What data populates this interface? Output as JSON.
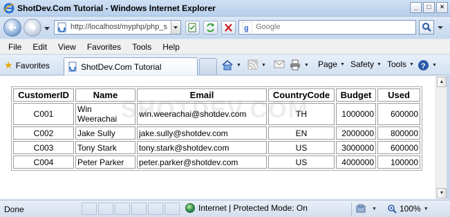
{
  "window": {
    "title": "ShotDev.Com Tutorial - Windows Internet Explorer",
    "controls": [
      "_",
      "□",
      "×"
    ]
  },
  "address": {
    "url": "http://localhost/myphp/php_s"
  },
  "search": {
    "placeholder": "Google"
  },
  "menu": [
    "File",
    "Edit",
    "View",
    "Favorites",
    "Tools",
    "Help"
  ],
  "favorites": {
    "label": "Favorites"
  },
  "tab": {
    "title": "ShotDev.Com Tutorial"
  },
  "commands": {
    "page": "Page",
    "safety": "Safety",
    "tools": "Tools"
  },
  "watermark": "SHOTDEV.COM",
  "table": {
    "headers": [
      "CustomerID",
      "Name",
      "Email",
      "CountryCode",
      "Budget",
      "Used"
    ],
    "rows": [
      [
        "C001",
        "Win Weerachai",
        "win.weerachai@shotdev.com",
        "TH",
        "1000000",
        "600000"
      ],
      [
        "C002",
        "Jake Sully",
        "jake.sully@shotdev.com",
        "EN",
        "2000000",
        "800000"
      ],
      [
        "C003",
        "Tony Stark",
        "tony.stark@shotdev.com",
        "US",
        "3000000",
        "600000"
      ],
      [
        "C004",
        "Peter Parker",
        "peter.parker@shotdev.com",
        "US",
        "4000000",
        "100000"
      ]
    ]
  },
  "status": {
    "text": "Done",
    "zone": "Internet | Protected Mode: On",
    "zoom": "100%"
  },
  "colors": {
    "titlebar": "#b8d0ec",
    "chrome": "#d3e1f1",
    "accent": "#4c72ac"
  },
  "icons": [
    "ie-logo-icon",
    "back-arrow-icon",
    "forward-arrow-icon",
    "page-icon",
    "compatibility-icon",
    "refresh-icon",
    "stop-icon",
    "google-icon",
    "search-icon",
    "favorites-star-icon",
    "home-icon",
    "feeds-icon",
    "mail-icon",
    "print-icon",
    "help-icon",
    "globe-icon",
    "protected-mode-icon",
    "zoom-icon"
  ]
}
